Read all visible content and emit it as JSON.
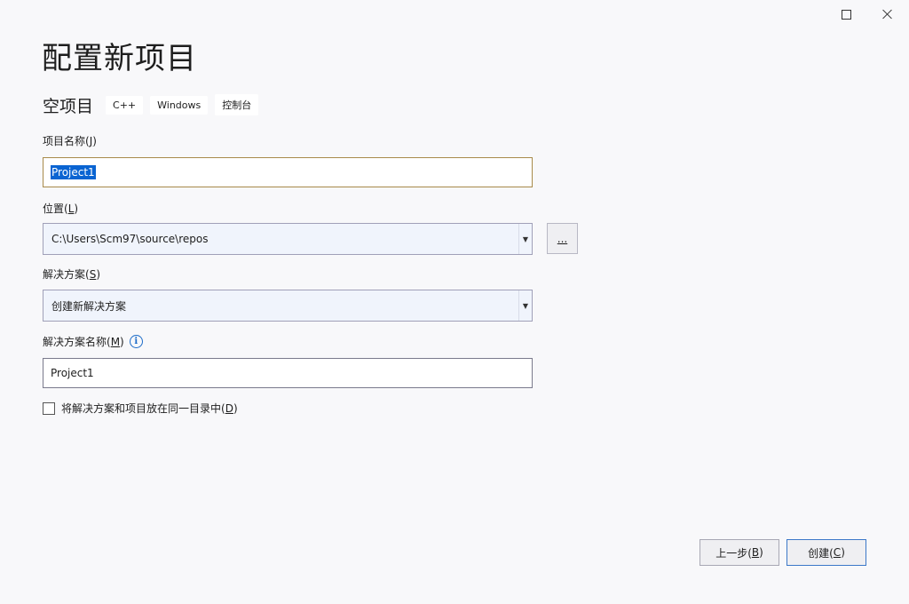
{
  "window": {
    "maximize_glyph": "maximize-icon",
    "close_glyph": "close-icon"
  },
  "page": {
    "title": "配置新项目"
  },
  "template": {
    "name": "空项目",
    "tags": [
      "C++",
      "Windows",
      "控制台"
    ]
  },
  "fields": {
    "project_name": {
      "label": "项目名称(J)",
      "label_text": "项目名称(",
      "label_key": "J",
      "label_end": ")",
      "value": "Project1"
    },
    "location": {
      "label_text": "位置(",
      "label_key": "L",
      "label_end": ")",
      "value": "C:\\Users\\Scm97\\source\\repos",
      "browse_label": "..."
    },
    "solution": {
      "label_text": "解决方案(",
      "label_key": "S",
      "label_end": ")",
      "value": "创建新解决方案"
    },
    "solution_name": {
      "label_text": "解决方案名称(",
      "label_key": "M",
      "label_end": ")",
      "info_icon": "i",
      "value": "Project1"
    },
    "same_directory": {
      "label_text": "将解决方案和项目放在同一目录中(",
      "label_key": "D",
      "label_end": ")",
      "checked": false
    }
  },
  "buttons": {
    "back": {
      "text": "上一步(",
      "key": "B",
      "end": ")"
    },
    "create": {
      "text": "创建(",
      "key": "C",
      "end": ")"
    }
  },
  "colors": {
    "accent": "#0a64d2",
    "focus_border": "#a88a4a",
    "info": "#1c6bc8"
  }
}
